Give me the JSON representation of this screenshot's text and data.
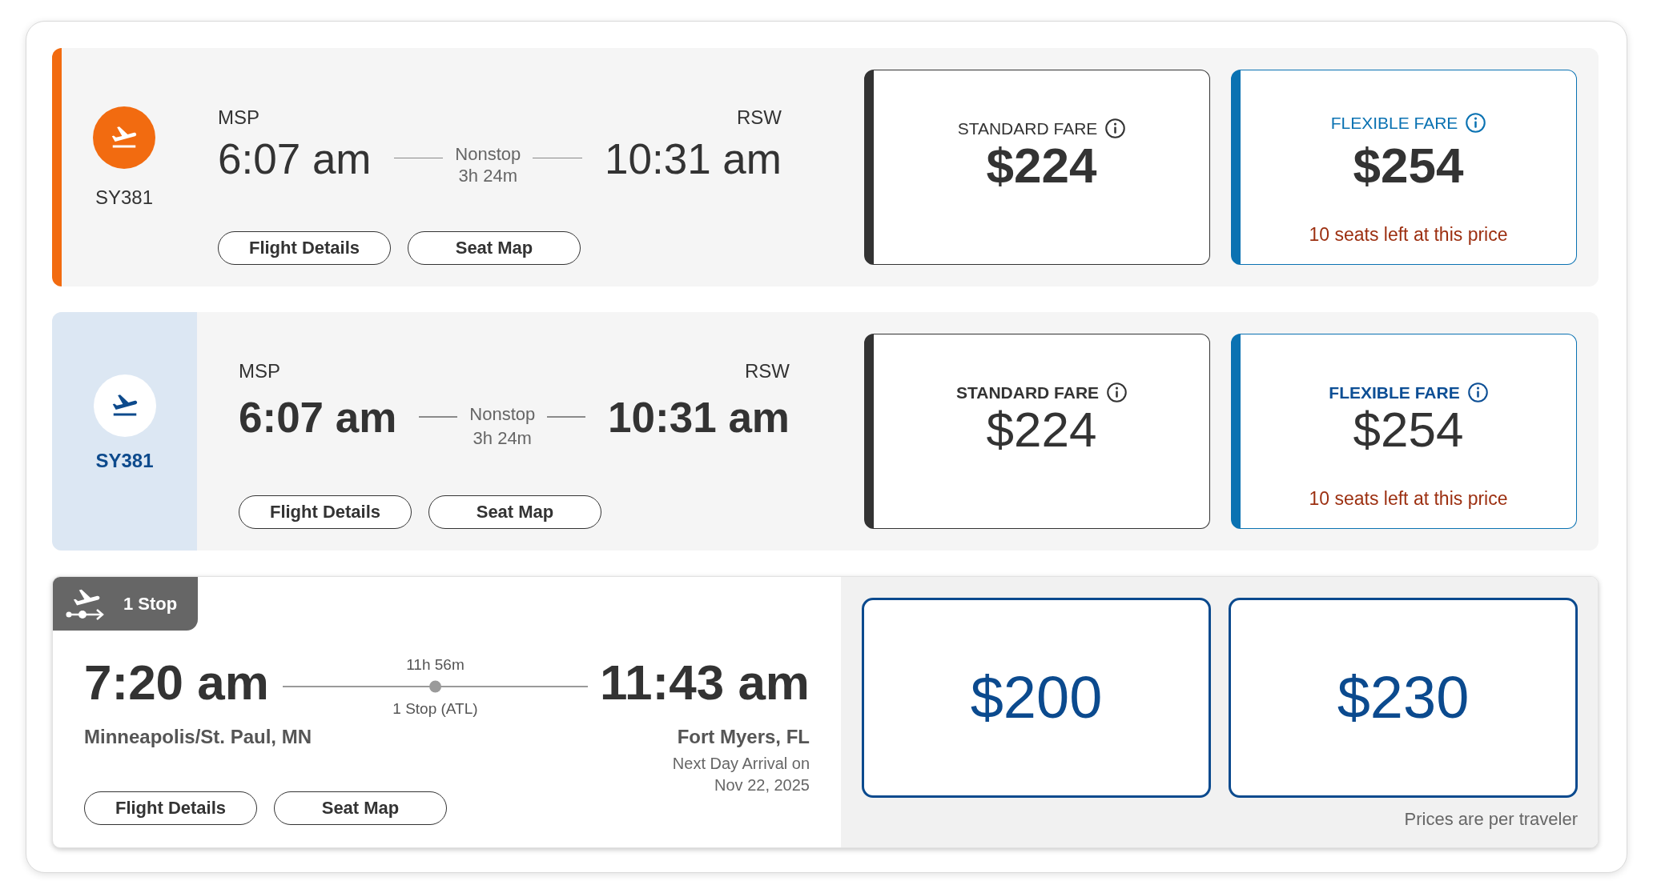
{
  "flight_cards": [
    {
      "kind": "accent_bar",
      "flight_number": "SY381",
      "departure": {
        "airport": "MSP",
        "time": "6:07 am"
      },
      "arrival": {
        "airport": "RSW",
        "time": "10:31 am"
      },
      "stops": "Nonstop",
      "duration": "3h 24m",
      "buttons": [
        "Flight Details",
        "Seat Map"
      ],
      "fares": [
        {
          "kind": "standard",
          "label": "STANDARD FARE",
          "price": "$224"
        },
        {
          "kind": "flexible",
          "label": "FLEXIBLE FARE",
          "price": "$254",
          "note": "10 seats left at this price"
        }
      ]
    },
    {
      "kind": "tinted_panel",
      "flight_number": "SY381",
      "departure": {
        "airport": "MSP",
        "time": "6:07 am"
      },
      "arrival": {
        "airport": "RSW",
        "time": "10:31 am"
      },
      "stops": "Nonstop",
      "duration": "3h 24m",
      "buttons": [
        "Flight Details",
        "Seat Map"
      ],
      "fares": [
        {
          "kind": "standard",
          "label": "STANDARD FARE",
          "price": "$224"
        },
        {
          "kind": "flexible",
          "label": "FLEXIBLE FARE",
          "price": "$254",
          "note": "10 seats left at this price"
        }
      ]
    },
    {
      "kind": "stop_badge",
      "badge": "1 Stop",
      "departure": {
        "time": "7:20 am",
        "city": "Minneapolis/St. Paul, MN"
      },
      "arrival": {
        "time": "11:43 am",
        "city": "Fort Myers, FL",
        "note": "Next Day Arrival on Nov 22, 2025"
      },
      "duration": "11h 56m",
      "stops": "1 Stop (ATL)",
      "buttons": [
        "Flight Details",
        "Seat Map"
      ],
      "fares": [
        {
          "kind": "plain",
          "price": "$200"
        },
        {
          "kind": "plain",
          "price": "$230"
        }
      ],
      "footnote": "Prices are per traveler"
    }
  ]
}
